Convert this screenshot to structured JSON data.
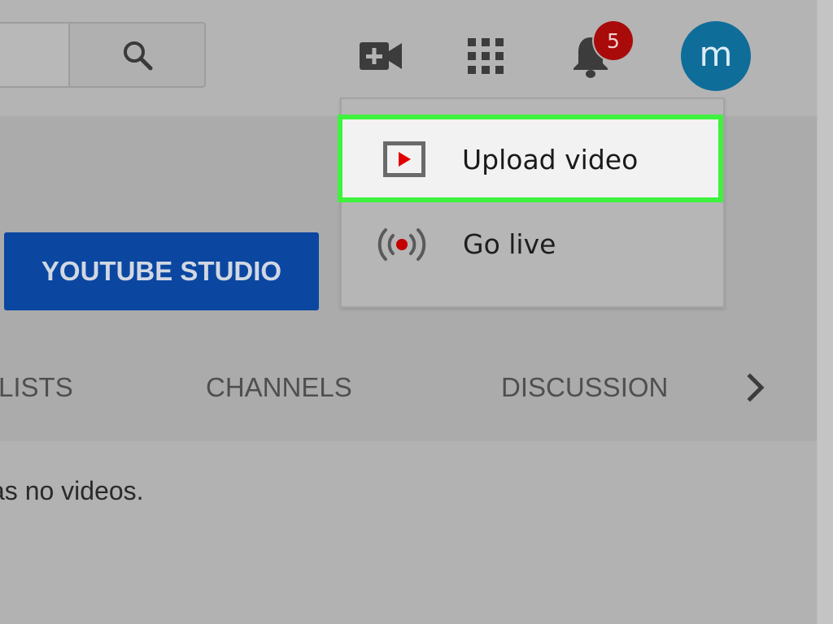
{
  "header": {
    "search": {
      "value": "",
      "placeholder": ""
    },
    "icons": {
      "search": "search-icon",
      "create": "video-camera-plus-icon",
      "apps": "grid-apps-icon",
      "notifications": "bell-icon"
    },
    "notification_count": "5",
    "avatar_letter": "m"
  },
  "create_menu": {
    "items": [
      {
        "label": "Upload video",
        "icon": "upload-video-icon",
        "highlighted": true
      },
      {
        "label": "Go live",
        "icon": "live-broadcast-icon",
        "highlighted": false
      }
    ]
  },
  "channel": {
    "studio_button": "YOUTUBE STUDIO",
    "tabs": [
      "LISTS",
      "CHANNELS",
      "DISCUSSION"
    ],
    "tabs_next_icon": "chevron-right-icon",
    "empty_message": "as no videos."
  },
  "colors": {
    "highlight_border": "#3ef23e",
    "studio_button": "#0b47a1",
    "badge": "#a90b0b",
    "avatar": "#0f6d99",
    "play_red": "#e00000",
    "live_dot": "#c40000"
  }
}
